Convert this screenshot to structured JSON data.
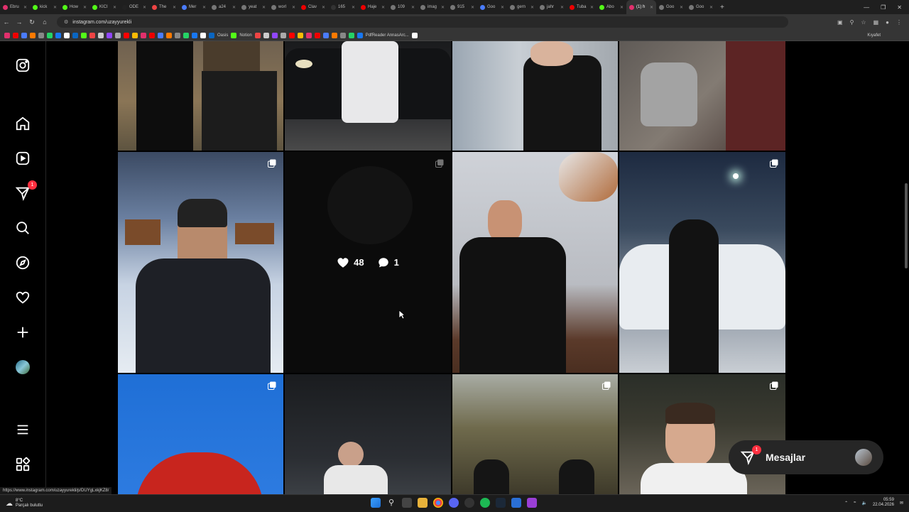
{
  "browser": {
    "tabs": [
      {
        "title": "Ebru",
        "color": "#e1306c"
      },
      {
        "title": "kick",
        "color": "#53fc18"
      },
      {
        "title": "How",
        "color": "#53fc18"
      },
      {
        "title": "KICI",
        "color": "#53fc18"
      },
      {
        "title": "ODE",
        "color": "#222"
      },
      {
        "title": "The",
        "color": "#e44"
      },
      {
        "title": "Mer",
        "color": "#4a7cff"
      },
      {
        "title": "a24",
        "color": "#777"
      },
      {
        "title": "yeat",
        "color": "#777"
      },
      {
        "title": "worl",
        "color": "#777"
      },
      {
        "title": "Clav",
        "color": "#e00"
      },
      {
        "title": "165",
        "color": "#333"
      },
      {
        "title": "Haje",
        "color": "#e00"
      },
      {
        "title": "109",
        "color": "#777"
      },
      {
        "title": "imag",
        "color": "#777"
      },
      {
        "title": "915",
        "color": "#777"
      },
      {
        "title": "Goo",
        "color": "#4a7cff"
      },
      {
        "title": "gern",
        "color": "#777"
      },
      {
        "title": "jahr",
        "color": "#777"
      },
      {
        "title": "Tuba",
        "color": "#e00"
      },
      {
        "title": "Abo",
        "color": "#53fc18"
      },
      {
        "title": "(1) h",
        "color": "#e1306c",
        "active": true
      },
      {
        "title": "Goo",
        "color": "#777"
      },
      {
        "title": "Goo",
        "color": "#777"
      }
    ],
    "new_tab": "+",
    "url": "instagram.com/uzayyurekli",
    "bookmarks_folder": "Kıyafet",
    "bookmark_labels": [
      "Oasis",
      "Notion",
      "PdfReader AnnasArc..."
    ],
    "status_url": "https://www.instagram.com/uzayyurekli/p/DUYgLxkjKZ8/"
  },
  "sidebar": {
    "items": [
      {
        "name": "instagram-logo"
      },
      {
        "name": "home"
      },
      {
        "name": "reels"
      },
      {
        "name": "direct",
        "badge": "1"
      },
      {
        "name": "search"
      },
      {
        "name": "explore"
      },
      {
        "name": "notifications"
      },
      {
        "name": "create"
      },
      {
        "name": "profile"
      },
      {
        "name": "more"
      },
      {
        "name": "also-from-meta"
      }
    ]
  },
  "hover_post": {
    "likes": "48",
    "comments": "1"
  },
  "messages": {
    "label": "Mesajlar",
    "badge": "1"
  },
  "taskbar": {
    "weather_temp": "8°C",
    "weather_desc": "Parçalı bulutlu",
    "time": "05:59",
    "date": "22.04.2026"
  }
}
